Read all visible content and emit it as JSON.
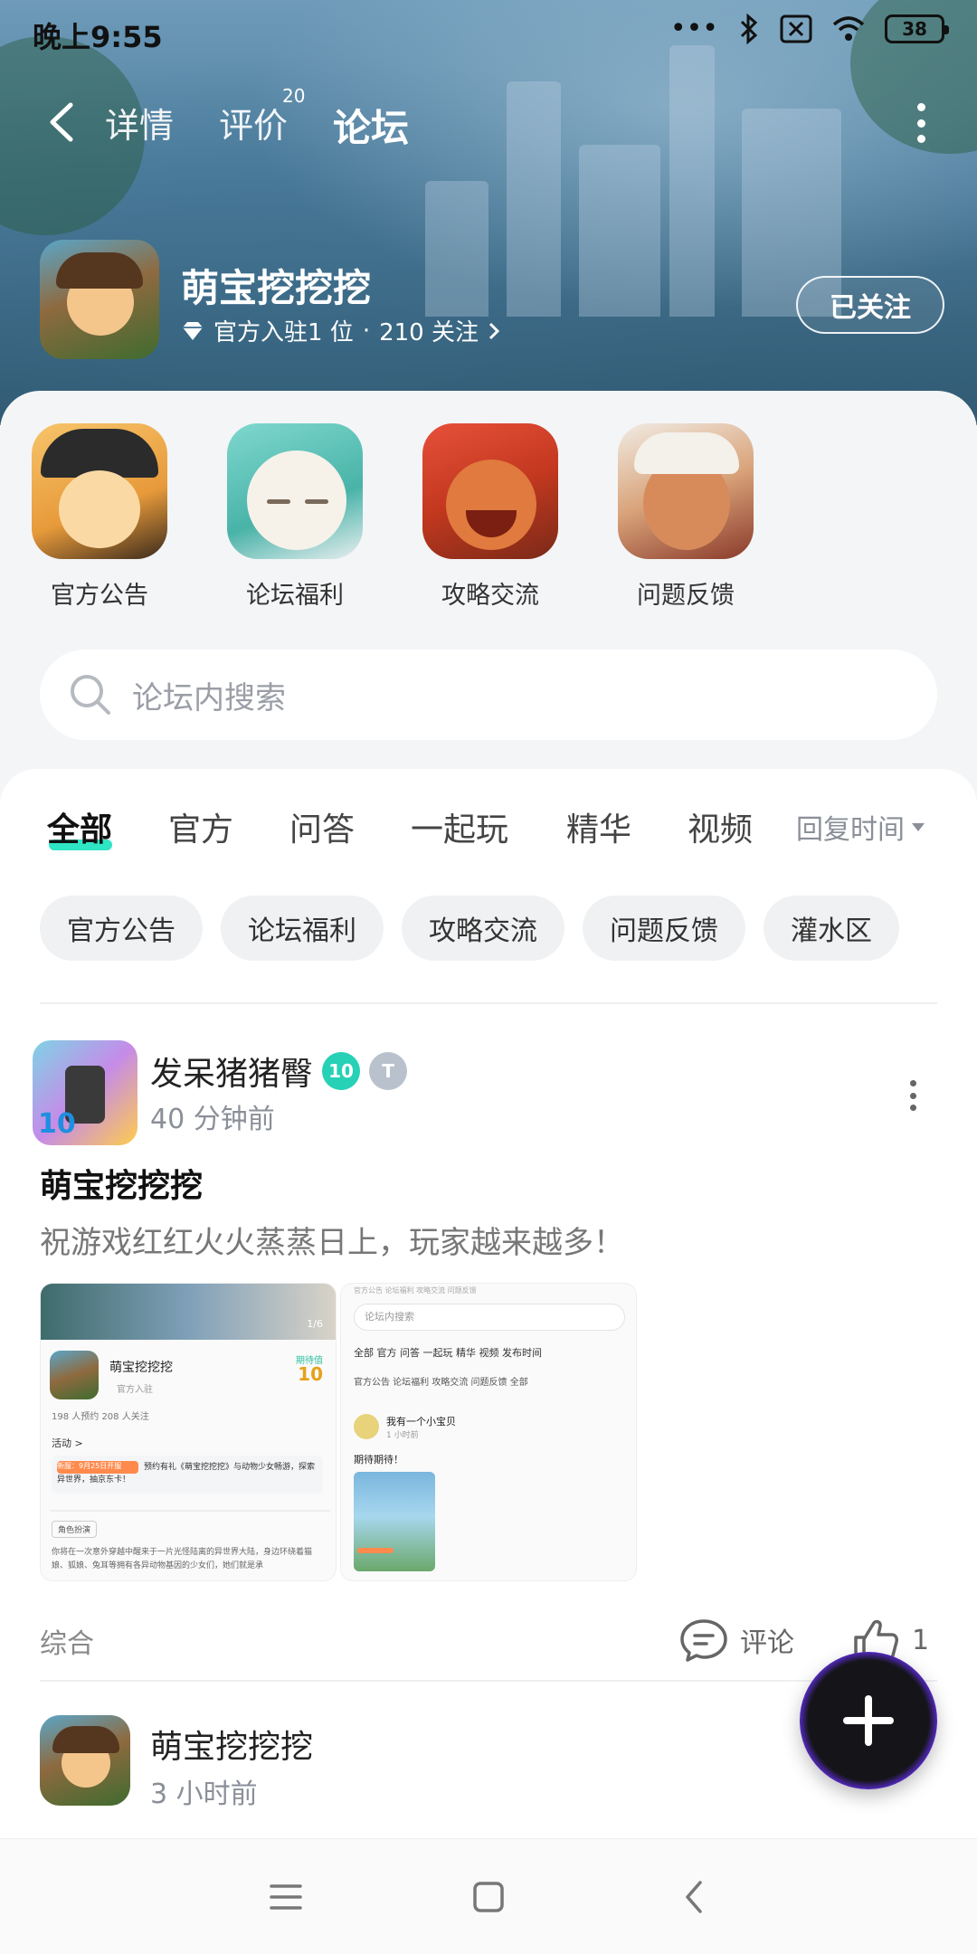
{
  "status_bar": {
    "time": "晚上9:55",
    "battery": "38",
    "icons": [
      "dots-icon",
      "bluetooth-icon",
      "sim-x-icon",
      "wifi-icon",
      "battery-icon"
    ]
  },
  "nav": {
    "tabs": [
      {
        "label": "详情",
        "active": false
      },
      {
        "label": "评价",
        "active": false,
        "badge": "20"
      },
      {
        "label": "论坛",
        "active": true
      }
    ]
  },
  "game": {
    "name": "萌宝挖挖挖",
    "official": "官方入驻1 位",
    "separator": "·",
    "followers": "210 关注",
    "follow_label": "已关注"
  },
  "categories": [
    {
      "label": "官方公告",
      "icon": "announcement-cat-icon"
    },
    {
      "label": "论坛福利",
      "icon": "welfare-cat-icon"
    },
    {
      "label": "攻略交流",
      "icon": "guide-cat-icon"
    },
    {
      "label": "问题反馈",
      "icon": "feedback-cat-icon"
    }
  ],
  "search": {
    "placeholder": "论坛内搜索"
  },
  "feed_tabs": {
    "items": [
      "全部",
      "官方",
      "问答",
      "一起玩",
      "精华",
      "视频"
    ],
    "active": "全部",
    "sort": "回复时间"
  },
  "chips": [
    "官方公告",
    "论坛福利",
    "攻略交流",
    "问题反馈",
    "灌水区"
  ],
  "posts": [
    {
      "author": "发呆猪猪臀",
      "level": "10",
      "medal": "T",
      "time": "40 分钟前",
      "title": "萌宝挖挖挖",
      "body": "祝游戏红红火火蒸蒸日上，玩家越来越多！",
      "tag": "综合",
      "comment_label": "评论",
      "likes": "1",
      "images": [
        {
          "counter": "1/6",
          "game_name": "萌宝挖挖挖",
          "official": "官方入驻",
          "score_label": "期待值",
          "score": "10",
          "stats": "198 人预约   208 人关注",
          "activity": "活动 >",
          "promo_tag": "新服：9月25日开服",
          "promo_text": "预约有礼《萌宝挖挖挖》与动物少女畅游，探索异世界，抽京东卡！",
          "section": "角色扮演",
          "desc": "你将在一次意外穿越中醒来于一片光怪陆离的异世界大陆，身边环绕着猫娘、狐娘、兔耳等拥有各异动物基因的少女们，她们就是承"
        },
        {
          "top_tabs": "官方公告   论坛福利   攻略交流   问题反馈",
          "search": "论坛内搜索",
          "tabs": "全部   官方   问答   一起玩   精华   视频   发布时间",
          "chips": "官方公告   论坛福利   攻略交流   问题反馈   全部",
          "author": "我有一个小宝贝",
          "time": "1 小时前",
          "text": "期待期待！"
        }
      ]
    },
    {
      "author": "萌宝挖挖挖",
      "time": "3 小时前"
    }
  ],
  "fab": {
    "icon": "plus-icon"
  },
  "system_nav": [
    "menu-icon",
    "home-icon",
    "back-icon"
  ],
  "colors": {
    "accent": "#2ee5c4",
    "banner": "#4f7f9f"
  }
}
